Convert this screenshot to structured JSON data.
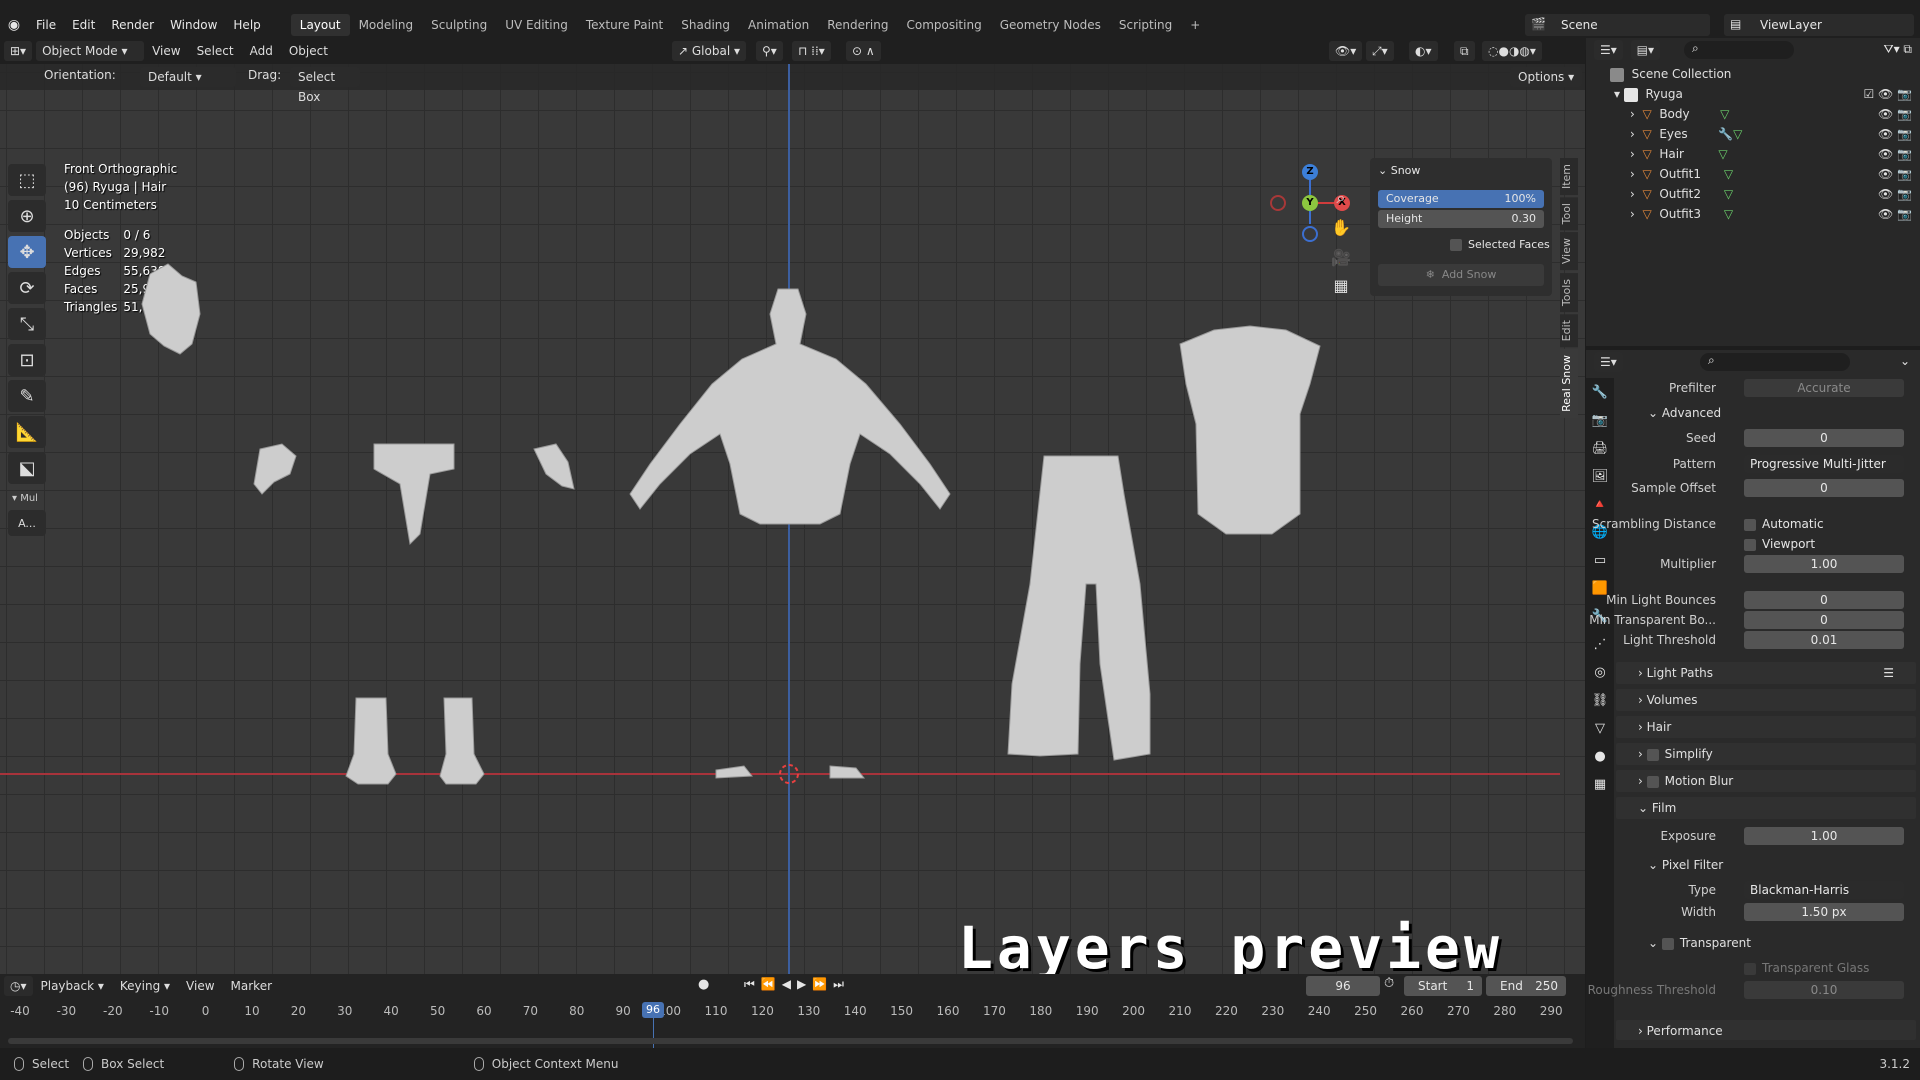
{
  "menubar": {
    "items": [
      "File",
      "Edit",
      "Render",
      "Window",
      "Help"
    ],
    "workspaces": [
      "Layout",
      "Modeling",
      "Sculpting",
      "UV Editing",
      "Texture Paint",
      "Shading",
      "Animation",
      "Rendering",
      "Compositing",
      "Geometry Nodes",
      "Scripting"
    ],
    "active_workspace": "Layout",
    "add_tab": "+",
    "scene": "Scene",
    "view_layer": "ViewLayer"
  },
  "header": {
    "mode": "Object Mode",
    "menus": [
      "View",
      "Select",
      "Add",
      "Object"
    ],
    "transform_orientation": "Global",
    "options": "Options"
  },
  "tool_header": {
    "orientation_label": "Orientation:",
    "orientation_value": "Default",
    "drag_label": "Drag:",
    "drag_value": "Select Box"
  },
  "viewport_info": {
    "view": "Front Orthographic",
    "object": "(96) Ryuga | Hair",
    "scale": "10 Centimeters",
    "stats": [
      {
        "label": "Objects",
        "value": "0 / 6"
      },
      {
        "label": "Vertices",
        "value": "29,982"
      },
      {
        "label": "Edges",
        "value": "55,638"
      },
      {
        "label": "Faces",
        "value": "25,990"
      },
      {
        "label": "Triangles",
        "value": "51,900"
      }
    ]
  },
  "toolbar": {
    "icons": [
      "select-box-icon",
      "cursor-icon",
      "move-icon",
      "rotate-icon",
      "scale-icon",
      "transform-icon",
      "annotate-icon",
      "measure-icon",
      "add-cube-icon"
    ],
    "active": "move-icon",
    "sub_label": "Mul",
    "sub_button": "A..."
  },
  "snow_panel": {
    "title": "Snow",
    "coverage_label": "Coverage",
    "coverage_value": "100%",
    "height_label": "Height",
    "height_value": "0.30",
    "selected_faces": "Selected Faces",
    "add_snow": "Add Snow"
  },
  "npanel_tabs": [
    "Item",
    "Tool",
    "View",
    "Tools",
    "Edit",
    "Real Snow"
  ],
  "gizmo": {
    "z": "Z",
    "y": "Y",
    "x": "X"
  },
  "overlay_title": "Layers preview",
  "timeline": {
    "menus": [
      "Playback",
      "Keying",
      "View",
      "Marker"
    ],
    "current_frame": "96",
    "start_label": "Start",
    "start_value": "1",
    "end_label": "End",
    "end_value": "250",
    "ticks": [
      "-40",
      "-30",
      "-20",
      "-10",
      "0",
      "10",
      "20",
      "30",
      "40",
      "50",
      "60",
      "70",
      "80",
      "90",
      "100",
      "110",
      "120",
      "130",
      "140",
      "150",
      "160",
      "170",
      "180",
      "190",
      "200",
      "210",
      "220",
      "230",
      "240",
      "250",
      "260",
      "270",
      "280",
      "290"
    ],
    "playhead_label": "96"
  },
  "statusbar": {
    "items": [
      "Select",
      "Box Select",
      "Rotate View",
      "Object Context Menu"
    ],
    "version": "3.1.2"
  },
  "outliner": {
    "root": "Scene Collection",
    "collection": "Ryuga",
    "objects": [
      "Body",
      "Eyes",
      "Hair",
      "Outfit1",
      "Outfit2",
      "Outfit3"
    ]
  },
  "properties": {
    "prefilter_label": "Prefilter",
    "prefilter_value": "Accurate",
    "advanced": "Advanced",
    "seed_label": "Seed",
    "seed_value": "0",
    "pattern_label": "Pattern",
    "pattern_value": "Progressive Multi-Jitter",
    "sample_offset_label": "Sample Offset",
    "sample_offset_value": "0",
    "scrambling_label": "Scrambling Distance",
    "automatic": "Automatic",
    "viewport": "Viewport",
    "multiplier_label": "Multiplier",
    "multiplier_value": "1.00",
    "min_bounces_label": "Min Light Bounces",
    "min_bounces_value": "0",
    "min_transparent_label": "Min Transparent Bo...",
    "min_transparent_value": "0",
    "light_threshold_label": "Light Threshold",
    "light_threshold_value": "0.01",
    "sections": [
      "Light Paths",
      "Volumes",
      "Hair",
      "Simplify",
      "Motion Blur",
      "Film"
    ],
    "exposure_label": "Exposure",
    "exposure_value": "1.00",
    "pixel_filter": "Pixel Filter",
    "type_label": "Type",
    "type_value": "Blackman-Harris",
    "width_label": "Width",
    "width_value": "1.50 px",
    "transparent": "Transparent",
    "transparent_glass": "Transparent Glass",
    "roughness_label": "Roughness Threshold",
    "roughness_value": "0.10",
    "performance": "Performance"
  },
  "colors": {
    "accent": "#4772b3",
    "axis_x": "#a8333b",
    "axis_z": "#3c5fa0",
    "object_orange": "#e0873a",
    "mesh_green": "#6bcf6b"
  }
}
